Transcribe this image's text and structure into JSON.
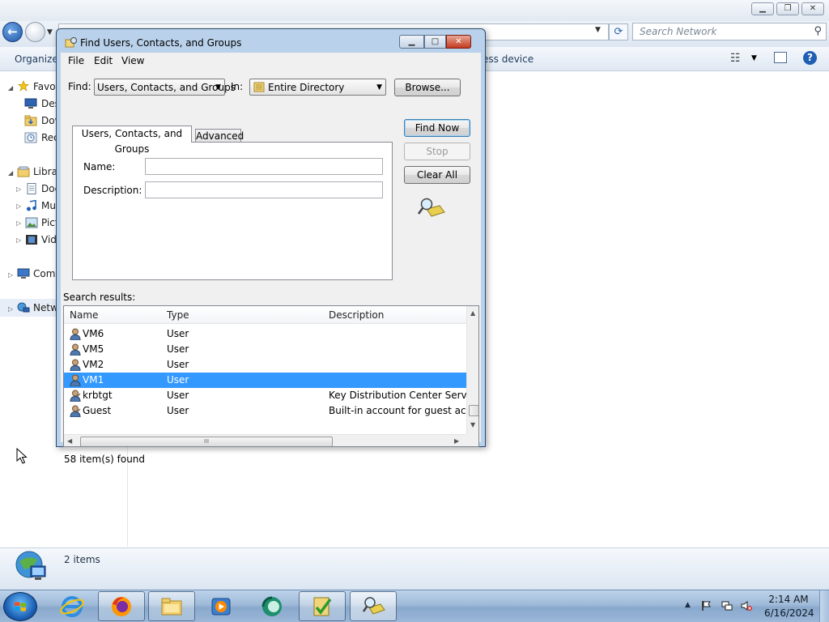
{
  "explorer": {
    "search_placeholder": "Search Network",
    "toolbar": {
      "organize": "Organize",
      "wireless_partial": "ess device"
    },
    "nav": {
      "favorites": "Favor",
      "desktop": "Des",
      "downloads": "Dov",
      "recent": "Rec",
      "libraries": "Libra",
      "documents": "Doc",
      "music": "Mu",
      "pictures": "Pict",
      "videos": "Vid",
      "computer": "Comp",
      "network": "Netw"
    },
    "details": {
      "count": "2 items"
    }
  },
  "dialog": {
    "title": "Find Users, Contacts, and Groups",
    "menu": {
      "file": "File",
      "edit": "Edit",
      "view": "View"
    },
    "find_label": "Find:",
    "find_value": "Users, Contacts, and Groups",
    "in_label": "In:",
    "in_value": "Entire Directory",
    "browse": "Browse...",
    "tabs": {
      "main": "Users, Contacts, and Groups",
      "advanced": "Advanced"
    },
    "name_label": "Name:",
    "name_value": "",
    "description_label": "Description:",
    "description_value": "",
    "find_now": "Find Now",
    "stop": "Stop",
    "clear_all": "Clear All",
    "results_label": "Search results:",
    "columns": {
      "name": "Name",
      "type": "Type",
      "description": "Description"
    },
    "rows": [
      {
        "name": "VM6",
        "type": "User",
        "description": ""
      },
      {
        "name": "VM5",
        "type": "User",
        "description": ""
      },
      {
        "name": "VM2",
        "type": "User",
        "description": ""
      },
      {
        "name": "VM1",
        "type": "User",
        "description": ""
      },
      {
        "name": "krbtgt",
        "type": "User",
        "description": "Key Distribution Center Service A"
      },
      {
        "name": "Guest",
        "type": "User",
        "description": "Built-in account for guest access"
      }
    ],
    "selected_row": "VM1",
    "hscroll_grip": "III",
    "status": "58 item(s) found"
  },
  "taskbar": {
    "apps": [
      "internet-explorer",
      "firefox",
      "file-explorer",
      "media-player",
      "remote-app",
      "checklist-app",
      "find-users-app"
    ],
    "time": "2:14 AM",
    "date": "6/16/2024"
  },
  "colors": {
    "selection": "#3399ff",
    "dialog_frame": "#b9d1ea",
    "taskbar": "#9fbad8"
  }
}
